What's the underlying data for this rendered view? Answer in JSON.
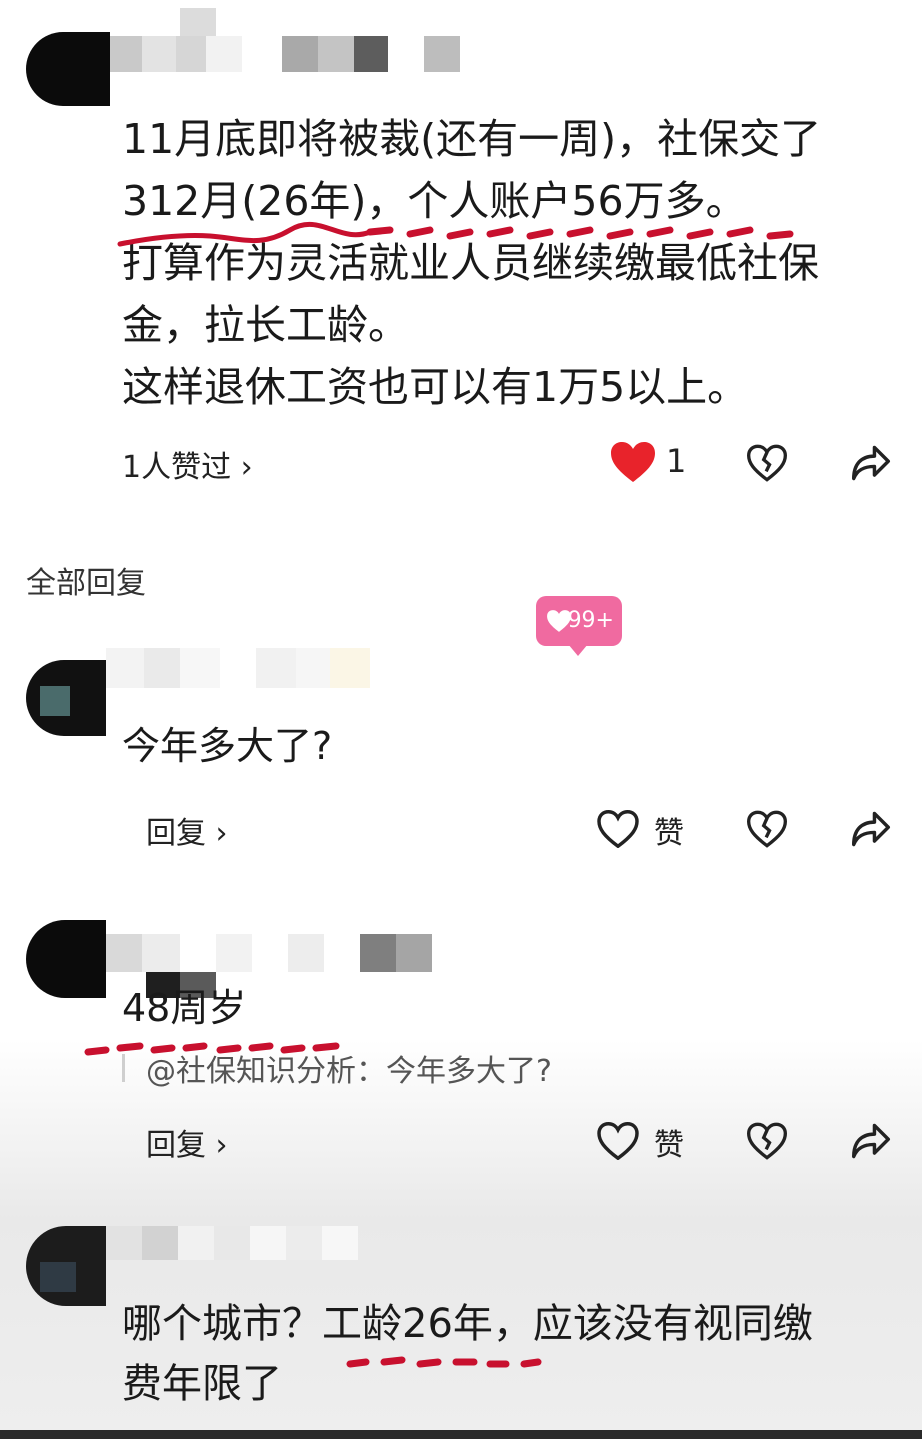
{
  "post": {
    "lines": [
      "11月底即将被裁(还有一周)，社保交了",
      "312月(26年)，个人账户56万多。",
      "打算作为灵活就业人员继续缴最低社保",
      "金，拉长工龄。",
      "这样退休工资也可以有1万5以上。"
    ],
    "likes_link": "1人赞过 ›",
    "like_count": "1"
  },
  "replies_section": {
    "title": "全部回复"
  },
  "badge": {
    "text": "99+"
  },
  "replies": [
    {
      "text": "今年多大了?",
      "reply_label": "回复 ›",
      "like_label": "赞"
    },
    {
      "text": "48周岁",
      "quote": "@社保知识分析：今年多大了?",
      "reply_label": "回复 ›",
      "like_label": "赞"
    },
    {
      "text_lines": [
        "哪个城市？工龄26年，应该没有视同缴",
        "费年限了"
      ]
    }
  ],
  "colors": {
    "heart_red": "#e8232b",
    "annotation_red": "#c8102e",
    "badge_pink": "#f06aa0"
  },
  "icons": [
    "heart-icon",
    "broken-heart-icon",
    "share-icon",
    "chevron-right-icon"
  ]
}
